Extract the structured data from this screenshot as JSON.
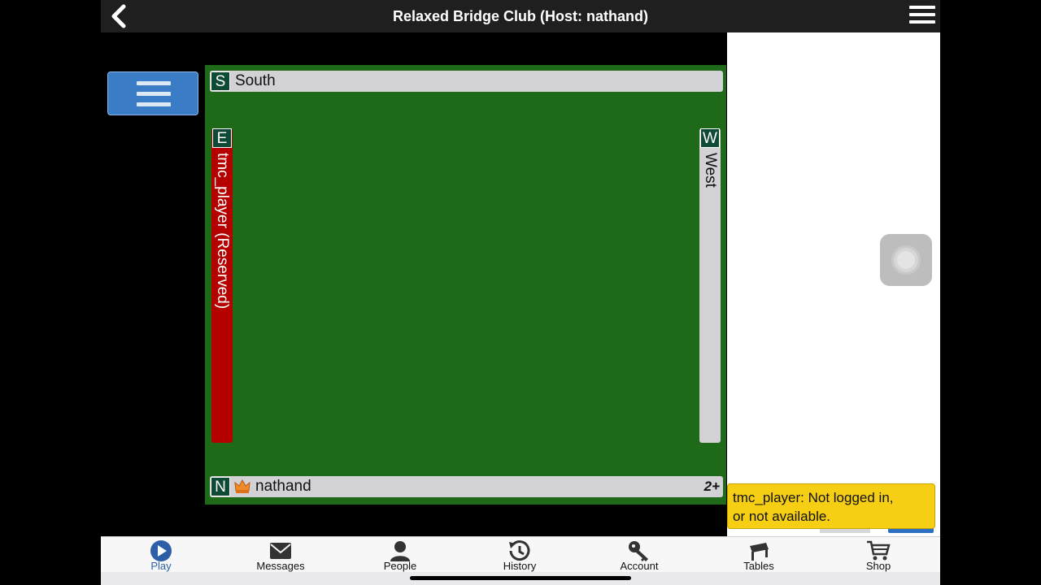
{
  "header": {
    "title": "Relaxed Bridge Club (Host: nathand)"
  },
  "table": {
    "seats": {
      "south": {
        "letter": "S",
        "name": "South"
      },
      "east": {
        "letter": "E",
        "name": "tmc_player (Reserved)",
        "status_color": "#b50000"
      },
      "west": {
        "letter": "W",
        "name": "West"
      },
      "north": {
        "letter": "N",
        "name": "nathand",
        "badge": "2+"
      }
    },
    "felt_color": "#1e6a18"
  },
  "tooltip": {
    "line1": "tmc_player: Not logged in,",
    "line2": "or not available."
  },
  "tabs": [
    {
      "label": "Play",
      "icon": "play-icon",
      "active": true
    },
    {
      "label": "Messages",
      "icon": "envelope-icon"
    },
    {
      "label": "People",
      "icon": "person-icon"
    },
    {
      "label": "History",
      "icon": "history-icon"
    },
    {
      "label": "Account",
      "icon": "key-icon"
    },
    {
      "label": "Tables",
      "icon": "table-icon"
    },
    {
      "label": "Shop",
      "icon": "cart-icon"
    }
  ],
  "colors": {
    "accent": "#3a7dc6",
    "tooltip": "#f6cf14",
    "seat_letter_bg": "#0e4a36"
  }
}
